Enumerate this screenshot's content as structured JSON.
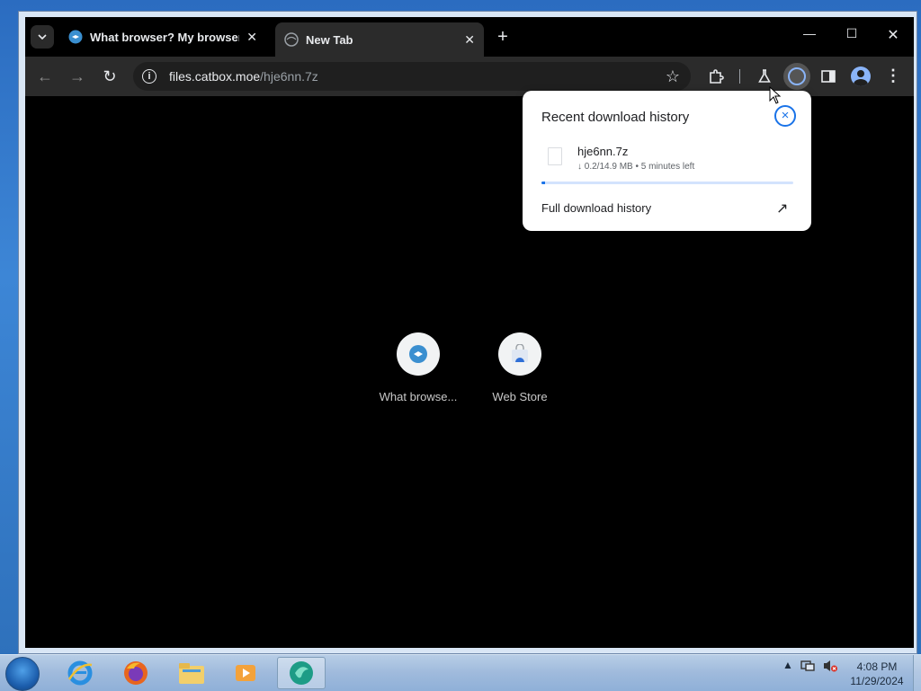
{
  "tabs": [
    {
      "title": "What browser? My browser? Is",
      "close": "✕",
      "active": false
    },
    {
      "title": "New Tab",
      "close": "✕",
      "active": true
    }
  ],
  "tab_search_icon": "chevron-down-icon",
  "new_tab_label": "+",
  "window_controls": {
    "minimize": "—",
    "maximize": "☐",
    "close": "✕"
  },
  "toolbar": {
    "back": "←",
    "forward": "→",
    "reload": "↻",
    "url_host": "files.catbox.moe",
    "url_path": "/hje6nn.7z",
    "bookmark_star": "☆",
    "menu": "⋮"
  },
  "download_bubble": {
    "title": "Recent download history",
    "close": "×",
    "filename": "hje6nn.7z",
    "status": "↓ 0.2/14.9 MB • 5 minutes left",
    "progress": 0.013,
    "full_history": "Full download history",
    "open_icon": "↗"
  },
  "shortcuts": [
    {
      "label": "What browse..."
    },
    {
      "label": "Web Store"
    }
  ],
  "taskbar": {
    "clock_time": "4:08 PM",
    "clock_date": "11/29/2024",
    "tray_arrow": "▲"
  },
  "colors": {
    "accent": "#1a73e8",
    "toolbar": "#2b2b2b",
    "content_bg": "#000000"
  }
}
